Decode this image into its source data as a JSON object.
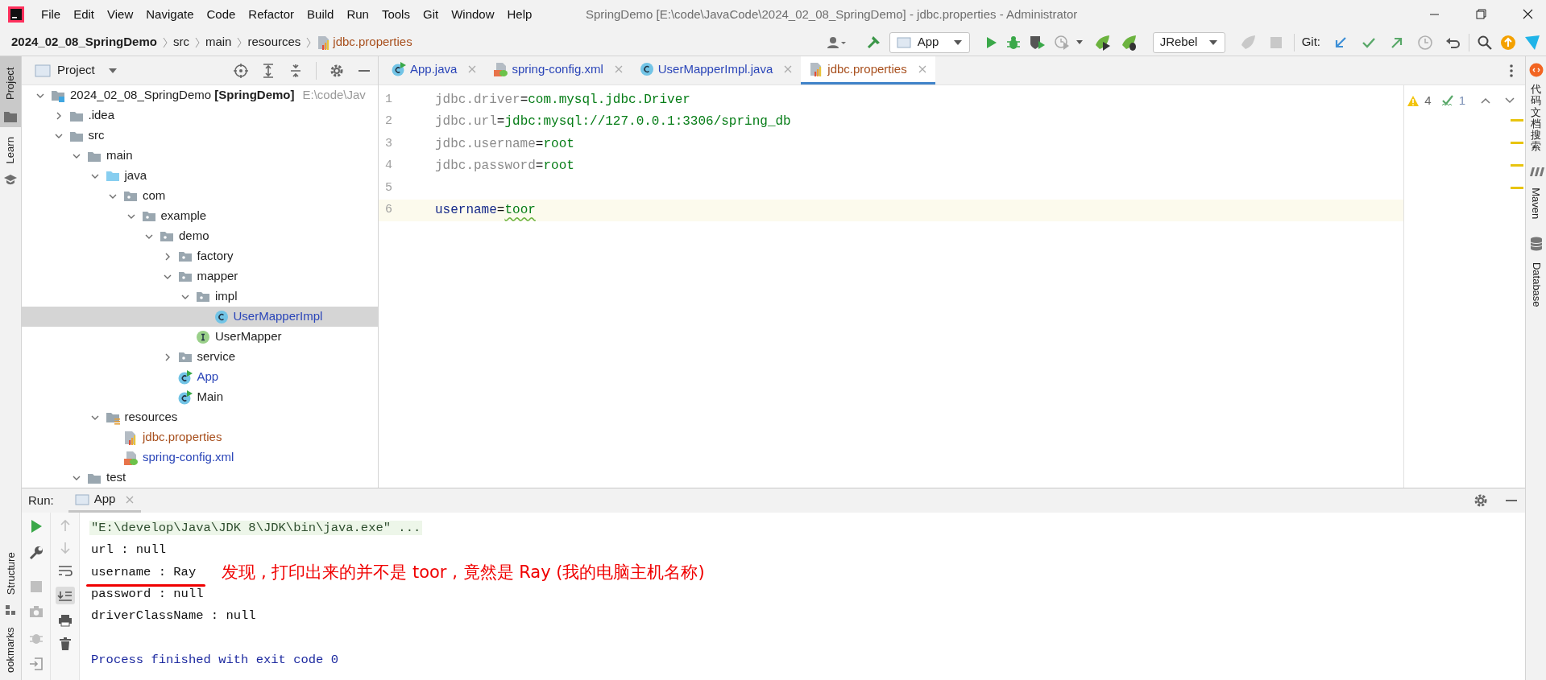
{
  "window": {
    "title": "SpringDemo [E:\\code\\JavaCode\\2024_02_08_SpringDemo] - jdbc.properties - Administrator"
  },
  "menu": [
    "File",
    "Edit",
    "View",
    "Navigate",
    "Code",
    "Refactor",
    "Build",
    "Run",
    "Tools",
    "Git",
    "Window",
    "Help"
  ],
  "breadcrumb": [
    {
      "label": "2024_02_08_SpringDemo",
      "kind": "project"
    },
    {
      "label": "src",
      "kind": "folder"
    },
    {
      "label": "main",
      "kind": "folder"
    },
    {
      "label": "resources",
      "kind": "folder"
    },
    {
      "label": "jdbc.properties",
      "kind": "properties",
      "color": "#a8501e"
    }
  ],
  "toolbar": {
    "run_config": "App",
    "jrebel_config": "JRebel",
    "git_label": "Git:"
  },
  "left_stripe": {
    "top": [
      {
        "label": "Project",
        "selected": true
      },
      {
        "label": "Learn",
        "selected": false
      }
    ],
    "bottom": [
      {
        "label": "Structure"
      },
      {
        "label": "ookmarks"
      }
    ]
  },
  "project_panel": {
    "title": "Project",
    "tree": [
      {
        "label": "2024_02_08_SpringDemo **[SpringDemo]**",
        "path": "E:\\code\\Jav",
        "kind": "module",
        "expanded": true,
        "selected": false,
        "children": [
          {
            "label": ".idea",
            "kind": "folder",
            "expanded": false,
            "selected": false
          },
          {
            "label": "src",
            "kind": "folder",
            "expanded": true,
            "selected": false,
            "children": [
              {
                "label": "main",
                "kind": "folder",
                "expanded": true,
                "selected": false,
                "children": [
                  {
                    "label": "java",
                    "kind": "source_root",
                    "expanded": true,
                    "selected": false,
                    "children": [
                      {
                        "label": "com",
                        "kind": "package",
                        "expanded": true,
                        "selected": false,
                        "children": [
                          {
                            "label": "example",
                            "kind": "package",
                            "expanded": true,
                            "selected": false,
                            "children": [
                              {
                                "label": "demo",
                                "kind": "package",
                                "expanded": true,
                                "selected": false,
                                "children": [
                                  {
                                    "label": "factory",
                                    "kind": "package",
                                    "expanded": false,
                                    "selected": false
                                  },
                                  {
                                    "label": "mapper",
                                    "kind": "package",
                                    "expanded": true,
                                    "selected": false,
                                    "children": [
                                      {
                                        "label": "impl",
                                        "kind": "package",
                                        "expanded": true,
                                        "selected": false,
                                        "children": [
                                          {
                                            "label": "UserMapperImpl",
                                            "kind": "class",
                                            "color": "#2a45b8",
                                            "selected": true
                                          }
                                        ]
                                      },
                                      {
                                        "label": "UserMapper",
                                        "kind": "interface",
                                        "selected": false
                                      }
                                    ]
                                  },
                                  {
                                    "label": "service",
                                    "kind": "package",
                                    "expanded": false,
                                    "selected": false
                                  },
                                  {
                                    "label": "App",
                                    "kind": "main_class",
                                    "color": "#2a45b8",
                                    "selected": false
                                  },
                                  {
                                    "label": "Main",
                                    "kind": "main_class",
                                    "selected": false
                                  }
                                ]
                              }
                            ]
                          }
                        ]
                      }
                    ]
                  },
                  {
                    "label": "resources",
                    "kind": "resources_root",
                    "expanded": true,
                    "selected": false,
                    "children": [
                      {
                        "label": "jdbc.properties",
                        "kind": "properties",
                        "color": "#a8501e",
                        "selected": false
                      },
                      {
                        "label": "spring-config.xml",
                        "kind": "xml",
                        "color": "#2a45b8",
                        "selected": false
                      }
                    ]
                  }
                ]
              },
              {
                "label": "test",
                "kind": "folder",
                "expanded": true,
                "selected": false
              }
            ]
          }
        ]
      }
    ]
  },
  "editor": {
    "tabs": [
      {
        "label": "App.java",
        "kind": "main_class",
        "color": "#2a45b8",
        "selected": false
      },
      {
        "label": "spring-config.xml",
        "kind": "xml",
        "color": "#2a45b8",
        "selected": false
      },
      {
        "label": "UserMapperImpl.java",
        "kind": "class",
        "color": "#2a45b8",
        "selected": false
      },
      {
        "label": "jdbc.properties",
        "kind": "properties",
        "color": "#a8501e",
        "selected": true
      }
    ],
    "lines": [
      {
        "number": "1",
        "key": "jdbc.driver",
        "separator": "=",
        "value": "com.mysql.jdbc.Driver",
        "unused": true,
        "current": false,
        "typo": false
      },
      {
        "number": "2",
        "key": "jdbc.url",
        "separator": "=",
        "value": "jdbc:mysql://127.0.0.1:3306/spring_db",
        "unused": true,
        "current": false,
        "typo": false
      },
      {
        "number": "3",
        "key": "jdbc.username",
        "separator": "=",
        "value": "root",
        "unused": true,
        "current": false,
        "typo": false
      },
      {
        "number": "4",
        "key": "jdbc.password",
        "separator": "=",
        "value": "root",
        "unused": true,
        "current": false,
        "typo": false
      },
      {
        "number": "5",
        "current": false
      },
      {
        "number": "6",
        "key": "username",
        "separator": "=",
        "value": "toor",
        "unused": false,
        "current": true,
        "typo": true
      }
    ],
    "warnings": "4",
    "typos": "1"
  },
  "right_stripe": [
    {
      "label": "代码文档搜索",
      "kind": "cjk"
    },
    {
      "label": "Maven",
      "kind": "maven"
    },
    {
      "label": "Database",
      "kind": "database"
    }
  ],
  "run_panel": {
    "label": "Run:",
    "tab": "App",
    "output": [
      {
        "text": "\"E:\\develop\\Java\\JDK 8\\JDK\\bin\\java.exe\" ...",
        "kind": "command"
      },
      {
        "text": "url : null",
        "kind": "stdout"
      },
      {
        "text": "username : Ray",
        "kind": "stdout",
        "annotation": "发现 , 打印出来的并不是 toor , 竟然是 Ray (我的电脑主机名称)"
      },
      {
        "text": "password : null",
        "kind": "stdout"
      },
      {
        "text": "driverClassName : null",
        "kind": "stdout"
      },
      {
        "kind": "blank"
      },
      {
        "text": "Process finished with exit code 0",
        "kind": "system"
      }
    ]
  }
}
